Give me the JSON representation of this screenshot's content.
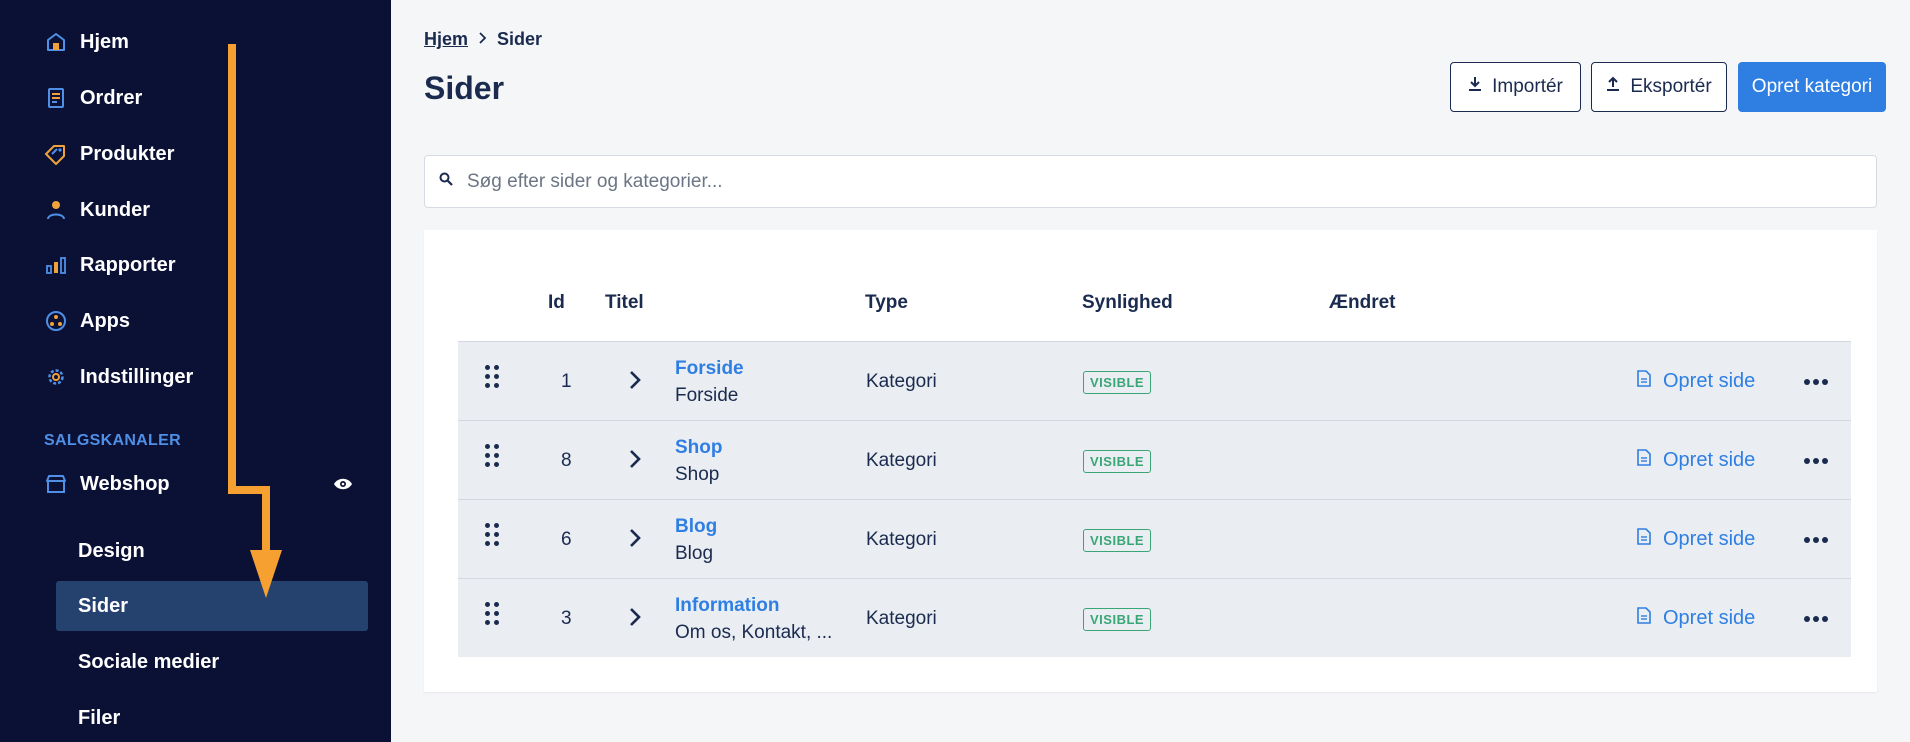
{
  "sidebar": {
    "nav": [
      {
        "label": "Hjem",
        "icon": "home-icon"
      },
      {
        "label": "Ordrer",
        "icon": "orders-icon"
      },
      {
        "label": "Produkter",
        "icon": "tag-icon"
      },
      {
        "label": "Kunder",
        "icon": "person-icon"
      },
      {
        "label": "Rapporter",
        "icon": "bar-chart-icon"
      },
      {
        "label": "Apps",
        "icon": "apps-icon"
      },
      {
        "label": "Indstillinger",
        "icon": "gear-icon"
      }
    ],
    "section_label": "SALGSKANALER",
    "channel": {
      "label": "Webshop",
      "icon": "store-icon",
      "visibility_icon": "eye-icon"
    },
    "sub_items": [
      {
        "label": "Design",
        "active": false
      },
      {
        "label": "Sider",
        "active": true
      },
      {
        "label": "Sociale medier",
        "active": false
      },
      {
        "label": "Filer",
        "active": false
      }
    ]
  },
  "breadcrumb": {
    "home": "Hjem",
    "current": "Sider"
  },
  "page_title": "Sider",
  "actions": {
    "import_label": "Importér",
    "export_label": "Eksportér",
    "create_category_label": "Opret kategori"
  },
  "search": {
    "placeholder": "Søg efter sider og kategorier..."
  },
  "table": {
    "headers": {
      "id": "Id",
      "title": "Titel",
      "type": "Type",
      "visibility": "Synlighed",
      "changed": "Ændret"
    },
    "rows": [
      {
        "id": "1",
        "title": "Forside",
        "subtitle": "Forside",
        "type": "Kategori",
        "visibility": "VISIBLE",
        "create_label": "Opret side"
      },
      {
        "id": "8",
        "title": "Shop",
        "subtitle": "Shop",
        "type": "Kategori",
        "visibility": "VISIBLE",
        "create_label": "Opret side"
      },
      {
        "id": "6",
        "title": "Blog",
        "subtitle": "Blog",
        "type": "Kategori",
        "visibility": "VISIBLE",
        "create_label": "Opret side"
      },
      {
        "id": "3",
        "title": "Information",
        "subtitle": "Om os, Kontakt, ...",
        "type": "Kategori",
        "visibility": "VISIBLE",
        "create_label": "Opret side"
      }
    ]
  },
  "colors": {
    "sidebar_bg": "#0b1135",
    "accent": "#2f7fe3",
    "icon_orange": "#f0a23a",
    "icon_blue": "#4f8fe6",
    "visible_green": "#3aa676",
    "arrow": "#f5a030"
  }
}
